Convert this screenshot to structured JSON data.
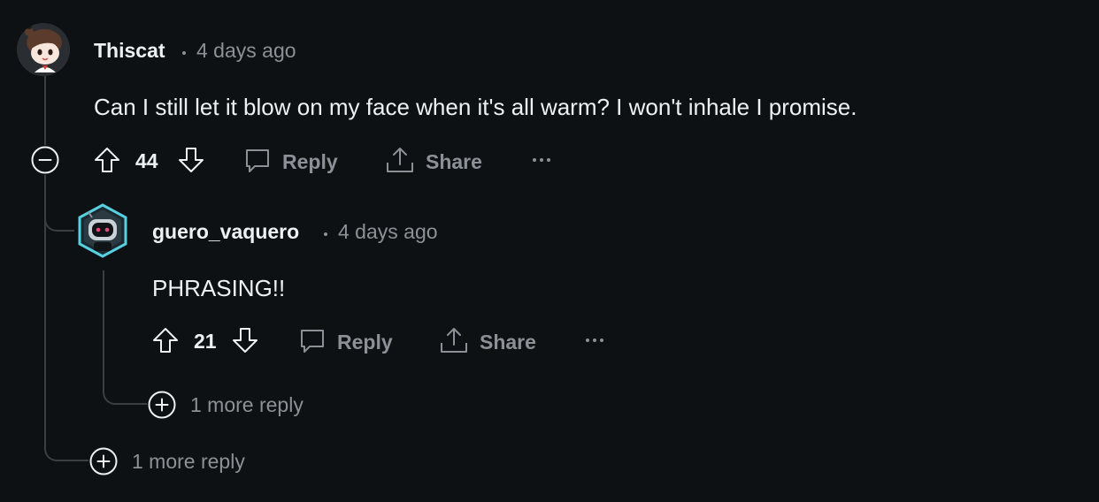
{
  "thread": {
    "comment": {
      "username": "Thiscat",
      "time": "4 days ago",
      "body": "Can I still let it blow on my face when it's all warm? I won't inhale I promise.",
      "score": "44",
      "reply_label": "Reply",
      "share_label": "Share",
      "more_replies": "1 more reply"
    },
    "reply": {
      "username": "guero_vaquero",
      "time": "4 days ago",
      "body": "PHRASING!!",
      "score": "21",
      "reply_label": "Reply",
      "share_label": "Share",
      "more_replies": "1 more reply"
    }
  },
  "icons": {
    "collapse": "minus-circle-icon",
    "expand": "plus-circle-icon",
    "upvote": "arrow-up-icon",
    "downvote": "arrow-down-icon",
    "reply": "speech-bubble-icon",
    "share": "share-icon",
    "more": "ellipsis-icon"
  },
  "colors": {
    "background": "#0e1113",
    "thread_line": "#3a3f43",
    "text_primary": "#eef1f3",
    "text_secondary": "#8b9196"
  }
}
